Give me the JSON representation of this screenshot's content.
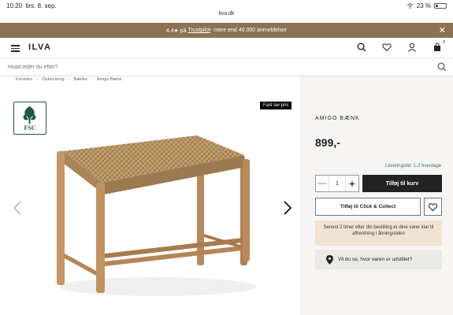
{
  "status_bar": {
    "time": "10.20",
    "date": "tirs. 8. sep.",
    "url": "ilva.dk",
    "battery": "23 %"
  },
  "promo": {
    "rating": "4.4★ på",
    "trustpilot": "Trustpilot",
    "rest": " - mere end 40.000 anmeldelser",
    "close": "✕"
  },
  "header": {
    "logo": "ILVA",
    "cart_count": "0"
  },
  "search": {
    "placeholder": "Hvad leder du efter?"
  },
  "breadcrumb": [
    "Forsiden",
    "Opbevaring",
    "Bænke",
    "Amigo Bænk"
  ],
  "gallery": {
    "fsc_label": "FSC",
    "badge": "Fast lav pris"
  },
  "product": {
    "name": "AMIGO BÆNK",
    "price": "899,-",
    "delivery": "Leveringstid: 1-2 hverdage",
    "quantity": "1",
    "minus": "—",
    "plus": "+",
    "add_to_cart": "Tilføj til kurv",
    "click_collect": "Tilføj til Click & Collect",
    "info": "Senest 2 timer efter din bestilling er dine varer klar til afhentning i åbningstiden",
    "location": "Vil du se, hvor varen er udstillet?"
  },
  "colors": {
    "promo_bg": "#8c7253",
    "panel_bg": "#f6f5f3",
    "info_bg": "#f0e3d2",
    "delivery_green": "#2f7b45",
    "button_dark": "#222222"
  }
}
